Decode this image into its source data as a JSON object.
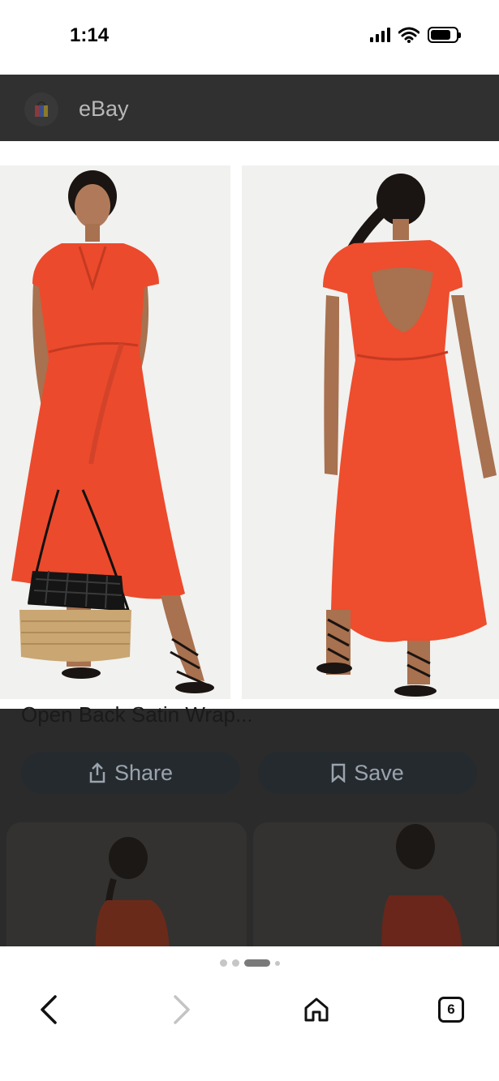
{
  "status_bar": {
    "time": "1:14",
    "icons": [
      "cellular-signal-icon",
      "wifi-icon",
      "battery-icon"
    ]
  },
  "site": {
    "name": "eBay",
    "icon": "shopping-bag-icon"
  },
  "product": {
    "title": "Open Back Satin Wrap...",
    "images": [
      {
        "icon": "photo-dress-front",
        "dress_color": "#ec4a2c"
      },
      {
        "icon": "photo-dress-back",
        "dress_color": "#ee4d2e"
      }
    ]
  },
  "actions": {
    "share_label": "Share",
    "save_label": "Save"
  },
  "browser": {
    "tab_count": "6",
    "page_dots": 4,
    "active_dot": 2
  },
  "colors": {
    "dress": "#ec4a2c",
    "overlay": "#2b2b2b",
    "header": "#303030"
  }
}
